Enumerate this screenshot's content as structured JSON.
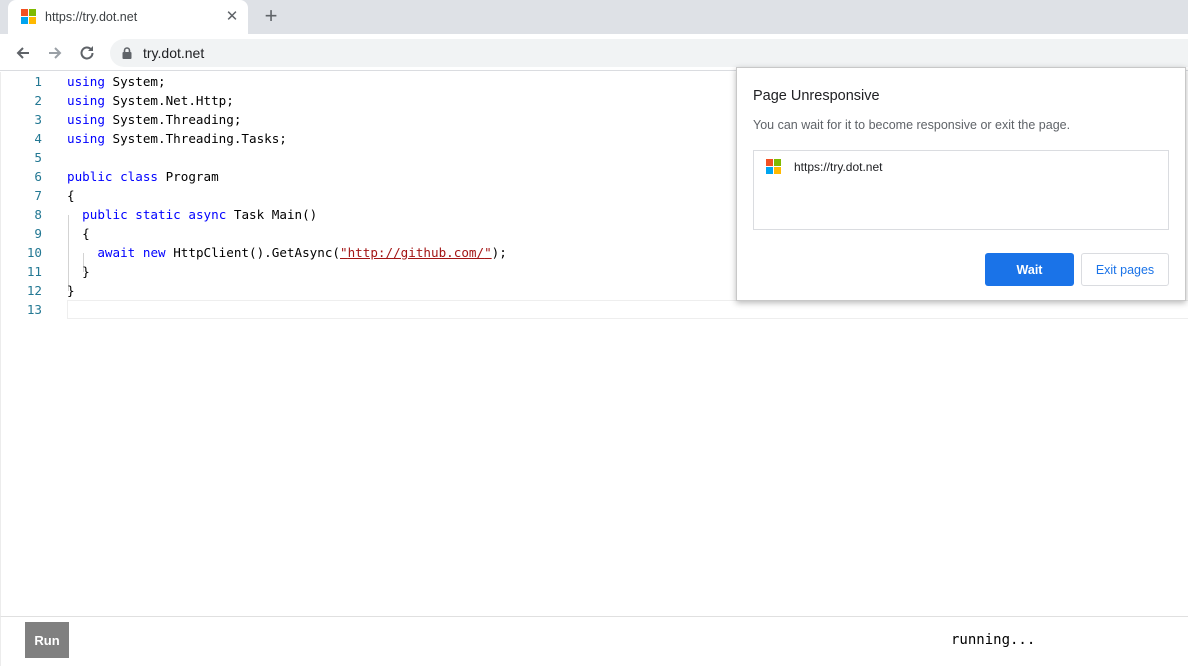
{
  "browser": {
    "tab": {
      "title": "https://try.dot.net",
      "favicon": "microsoft-logo",
      "close_icon": "close-icon"
    },
    "new_tab_icon": "plus-icon",
    "nav": {
      "back_icon": "back-arrow-icon",
      "forward_icon": "forward-arrow-icon",
      "reload_icon": "reload-icon"
    },
    "address": {
      "url": "try.dot.net",
      "lock_icon": "lock-icon"
    }
  },
  "editor": {
    "line_numbers": [
      "1",
      "2",
      "3",
      "4",
      "5",
      "6",
      "7",
      "8",
      "9",
      "10",
      "11",
      "12",
      "13"
    ],
    "lines": [
      [
        {
          "t": "using",
          "k": "kw"
        },
        {
          "t": " System;"
        }
      ],
      [
        {
          "t": "using",
          "k": "kw"
        },
        {
          "t": " System.Net.Http;"
        }
      ],
      [
        {
          "t": "using",
          "k": "kw"
        },
        {
          "t": " System.Threading;"
        }
      ],
      [
        {
          "t": "using",
          "k": "kw"
        },
        {
          "t": " System.Threading.Tasks;"
        }
      ],
      [],
      [
        {
          "t": "public",
          "k": "kw"
        },
        {
          "t": " "
        },
        {
          "t": "class",
          "k": "kw"
        },
        {
          "t": " Program"
        }
      ],
      [
        {
          "t": "{"
        }
      ],
      [
        {
          "t": "  "
        },
        {
          "t": "public",
          "k": "kw"
        },
        {
          "t": " "
        },
        {
          "t": "static",
          "k": "kw"
        },
        {
          "t": " "
        },
        {
          "t": "async",
          "k": "kw"
        },
        {
          "t": " Task Main()"
        }
      ],
      [
        {
          "t": "  {"
        }
      ],
      [
        {
          "t": "    "
        },
        {
          "t": "await",
          "k": "kw"
        },
        {
          "t": " "
        },
        {
          "t": "new",
          "k": "kw"
        },
        {
          "t": " HttpClient().GetAsync("
        },
        {
          "t": "\"",
          "k": "str"
        },
        {
          "t": "http://github.com/",
          "k": "str"
        },
        {
          "t": "\"",
          "k": "str"
        },
        {
          "t": ");"
        }
      ],
      [
        {
          "t": "  }"
        }
      ],
      [
        {
          "t": "}"
        }
      ],
      []
    ],
    "colors": {
      "keyword": "#0000ff",
      "string": "#a31515",
      "line_number": "#237893"
    }
  },
  "footer": {
    "run_label": "Run",
    "status": "running..."
  },
  "dialog": {
    "title": "Page Unresponsive",
    "message": "You can wait for it to become responsive or exit the page.",
    "pages": [
      {
        "url": "https://try.dot.net",
        "favicon": "microsoft-logo"
      }
    ],
    "wait_label": "Wait",
    "exit_label": "Exit pages",
    "accent": "#1a73e8"
  }
}
